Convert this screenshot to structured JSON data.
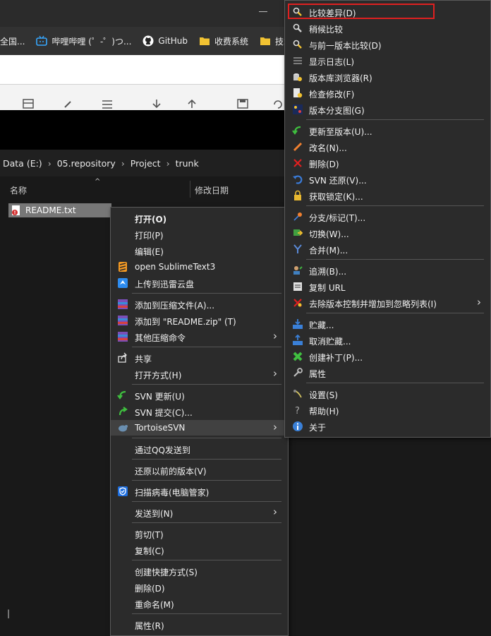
{
  "bookmarks": [
    {
      "label": "全国...",
      "icon": "page-icon"
    },
    {
      "label": "哔哩哔哩 (゜-゜)つ...",
      "icon": "bilibili-icon"
    },
    {
      "label": "GitHub",
      "icon": "github-icon"
    },
    {
      "label": "收费系统",
      "icon": "folder-icon"
    },
    {
      "label": "技术",
      "icon": "folder-icon"
    }
  ],
  "breadcrumb": [
    "Data (E:)",
    "05.repository",
    "Project",
    "trunk"
  ],
  "columns": {
    "name": "名称",
    "date": "修改日期"
  },
  "file": {
    "name": "README.txt"
  },
  "status_text": "|",
  "context_menu": [
    {
      "label": "打开(O)",
      "bold": true,
      "icon": ""
    },
    {
      "label": "打印(P)",
      "icon": ""
    },
    {
      "label": "编辑(E)",
      "icon": ""
    },
    {
      "label": "open SublimeText3",
      "icon": "sublime-icon"
    },
    {
      "label": "上传到迅雷云盘",
      "icon": "thunder-cloud-icon"
    },
    {
      "label": "添加到压缩文件(A)...",
      "icon": "winrar-icon"
    },
    {
      "label": "添加到 \"README.zip\" (T)",
      "icon": "winrar-icon"
    },
    {
      "label": "其他压缩命令",
      "icon": "winrar-icon",
      "submenu": true
    },
    {
      "label": "共享",
      "icon": "share-icon"
    },
    {
      "label": "打开方式(H)",
      "icon": "",
      "submenu": true
    },
    {
      "label": "SVN 更新(U)",
      "icon": "svn-update-icon"
    },
    {
      "label": "SVN 提交(C)...",
      "icon": "svn-commit-icon"
    },
    {
      "label": "TortoiseSVN",
      "icon": "tortoisesvn-icon",
      "submenu": true,
      "highlighted": true
    },
    {
      "label": "通过QQ发送到",
      "icon": ""
    },
    {
      "label": "还原以前的版本(V)",
      "icon": ""
    },
    {
      "label": "扫描病毒(电脑管家)",
      "icon": "shield-icon"
    },
    {
      "label": "发送到(N)",
      "icon": "",
      "submenu": true
    },
    {
      "label": "剪切(T)",
      "icon": ""
    },
    {
      "label": "复制(C)",
      "icon": ""
    },
    {
      "label": "创建快捷方式(S)",
      "icon": ""
    },
    {
      "label": "删除(D)",
      "icon": ""
    },
    {
      "label": "重命名(M)",
      "icon": ""
    },
    {
      "label": "属性(R)",
      "icon": ""
    }
  ],
  "svn_menu": [
    {
      "label": "比较差异(D)",
      "icon": "diff-icon",
      "highlighted": true
    },
    {
      "label": "稍候比较",
      "icon": "diff-later-icon"
    },
    {
      "label": "与前一版本比较(D)",
      "icon": "diff-previous-icon"
    },
    {
      "label": "显示日志(L)",
      "icon": "log-icon"
    },
    {
      "label": "版本库浏览器(R)",
      "icon": "repo-browser-icon"
    },
    {
      "label": "检查修改(F)",
      "icon": "check-modifications-icon"
    },
    {
      "label": "版本分支图(G)",
      "icon": "revision-graph-icon"
    },
    {
      "label": "更新至版本(U)...",
      "icon": "update-to-revision-icon"
    },
    {
      "label": "改名(N)...",
      "icon": "rename-icon"
    },
    {
      "label": "删除(D)",
      "icon": "delete-icon"
    },
    {
      "label": "SVN 还原(V)...",
      "icon": "revert-icon"
    },
    {
      "label": "获取锁定(K)...",
      "icon": "lock-icon"
    },
    {
      "label": "分支/标记(T)...",
      "icon": "branch-icon"
    },
    {
      "label": "切换(W)...",
      "icon": "switch-icon"
    },
    {
      "label": "合并(M)...",
      "icon": "merge-icon"
    },
    {
      "label": "追溯(B)...",
      "icon": "blame-icon"
    },
    {
      "label": "复制 URL",
      "icon": "copy-url-icon"
    },
    {
      "label": "去除版本控制并增加到忽略列表(I)",
      "icon": "ignore-icon",
      "submenu": true
    },
    {
      "label": "贮藏...",
      "icon": "shelve-icon"
    },
    {
      "label": "取消贮藏...",
      "icon": "unshelve-icon"
    },
    {
      "label": "创建补丁(P)...",
      "icon": "patch-icon"
    },
    {
      "label": "属性",
      "icon": "properties-icon"
    },
    {
      "label": "设置(S)",
      "icon": "settings-icon"
    },
    {
      "label": "帮助(H)",
      "icon": "help-icon"
    },
    {
      "label": "关于",
      "icon": "about-icon"
    }
  ]
}
